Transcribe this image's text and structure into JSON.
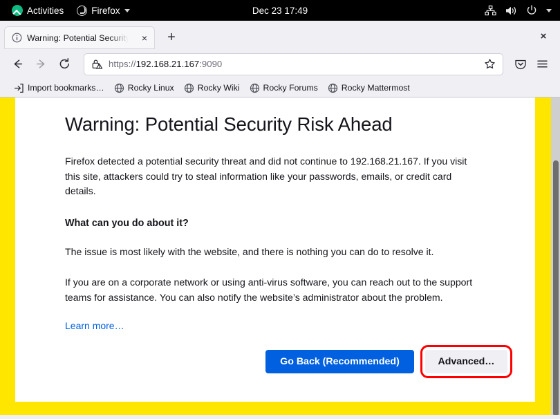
{
  "desktop": {
    "activities_label": "Activities",
    "app_menu_label": "Firefox",
    "clock": "Dec 23  17:49",
    "icons": {
      "network": "network-icon",
      "volume": "volume-icon",
      "power": "power-icon",
      "menu_caret": "chevron-down-icon"
    }
  },
  "browser": {
    "tab": {
      "title": "Warning: Potential Security Risk Ahead",
      "favicon": "info-circle-icon",
      "close_label": "×"
    },
    "newtab_label": "+",
    "window_close_label": "×",
    "nav": {
      "back_label": "back-icon",
      "forward_label": "forward-icon",
      "reload_label": "reload-icon"
    },
    "urlbar": {
      "scheme": "https://",
      "host": "192.168.21.167",
      "port": ":9090",
      "full_url": "https://192.168.21.167:9090",
      "security_icon": "broken-lock-warning-icon",
      "bookmark_icon": "star-icon"
    },
    "toolbar": {
      "save_to_pocket_icon": "pocket-icon",
      "app_menu_icon": "hamburger-menu-icon"
    },
    "bookmarks": [
      {
        "label": "Import bookmarks…",
        "icon": "import-icon"
      },
      {
        "label": "Rocky Linux",
        "icon": "globe-icon"
      },
      {
        "label": "Rocky Wiki",
        "icon": "globe-icon"
      },
      {
        "label": "Rocky Forums",
        "icon": "globe-icon"
      },
      {
        "label": "Rocky Mattermost",
        "icon": "globe-icon"
      }
    ]
  },
  "page": {
    "title": "Warning: Potential Security Risk Ahead",
    "paragraph1": "Firefox detected a potential security threat and did not continue to 192.168.21.167. If you visit this site, attackers could try to steal information like your passwords, emails, or credit card details.",
    "subheading": "What can you do about it?",
    "paragraph2": "The issue is most likely with the website, and there is nothing you can do to resolve it.",
    "paragraph3": "If you are on a corporate network or using anti-virus software, you can reach out to the support teams for assistance. You can also notify the website’s administrator about the problem.",
    "learn_more": "Learn more…",
    "go_back_button": "Go Back (Recommended)",
    "advanced_button": "Advanced…"
  },
  "colors": {
    "accent_blue": "#0060df",
    "link_blue": "#0060df",
    "page_frame_yellow": "#ffe600",
    "highlight_red": "#ff0000",
    "topbar_black": "#000000",
    "chrome_grey": "#f0f0f4"
  }
}
